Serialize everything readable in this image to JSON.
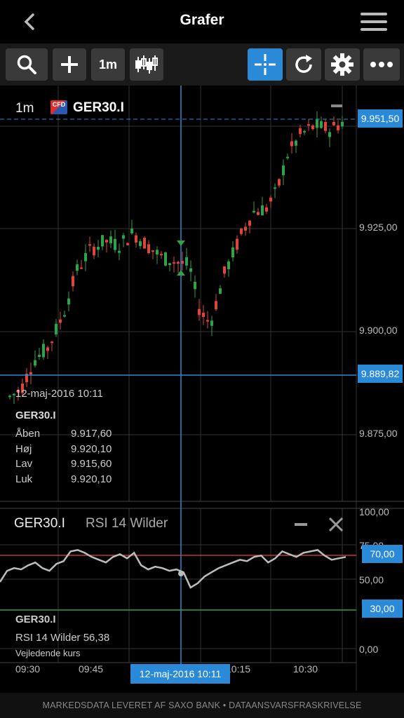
{
  "header": {
    "title": "Grafer"
  },
  "toolbar": {
    "interval_label": "1m"
  },
  "chart": {
    "interval": "1m",
    "instrument_badge": "CFD",
    "instrument": "GER30.I",
    "price_tag_last": "9.951,50",
    "price_tag_cursor": "9.889,82",
    "price_axis": [
      "9.925,00",
      "9.900,00",
      "9.875,00"
    ],
    "tooltip": {
      "date": "12-maj-2016 10:11",
      "instrument": "GER30.I",
      "rows": [
        {
          "label": "Åben",
          "value": "9.917,60"
        },
        {
          "label": "Høj",
          "value": "9.920,10"
        },
        {
          "label": "Lav",
          "value": "9.915,60"
        },
        {
          "label": "Luk",
          "value": "9.920,10"
        }
      ]
    }
  },
  "rsi": {
    "instrument": "GER30.I",
    "indicator": "RSI 14 Wilder",
    "axis": [
      "100,00",
      "50,00",
      "0,00"
    ],
    "axis_partial": "75,00",
    "upper_tag": "70,00",
    "lower_tag": "30,00",
    "readout_instrument": "GER30.I",
    "readout_value": "RSI 14 Wilder 56,38",
    "readout_note": "Vejledende kurs"
  },
  "time_axis": {
    "labels": [
      "09:30",
      "09:45",
      "10:15",
      "10:30"
    ],
    "cursor_date": "12-maj-2016 10:11"
  },
  "footer": {
    "text": "MARKEDSDATA LEVERET AF SAXO BANK • DATAANSVARSFRASKRIVELSE"
  },
  "colors": {
    "accent": "#2a8ad8",
    "up": "#2fa24a",
    "down": "#e0453a",
    "rsi_line": "#bdbdbd"
  },
  "chart_data": {
    "type": "candlestick",
    "instrument": "GER30.I",
    "interval": "1m",
    "y_axis_ticks": [
      9925,
      9900,
      9875
    ],
    "last_price": 9951.5,
    "cursor_price": 9889.82,
    "cursor_time": "12-maj-2016 10:11",
    "cursor_ohlc": {
      "open": 9917.6,
      "high": 9920.1,
      "low": 9915.6,
      "close": 9920.1
    },
    "rsi": {
      "name": "RSI 14 Wilder",
      "value": 56.38,
      "upper": 70,
      "lower": 30,
      "ylim": [
        0,
        100
      ]
    }
  }
}
